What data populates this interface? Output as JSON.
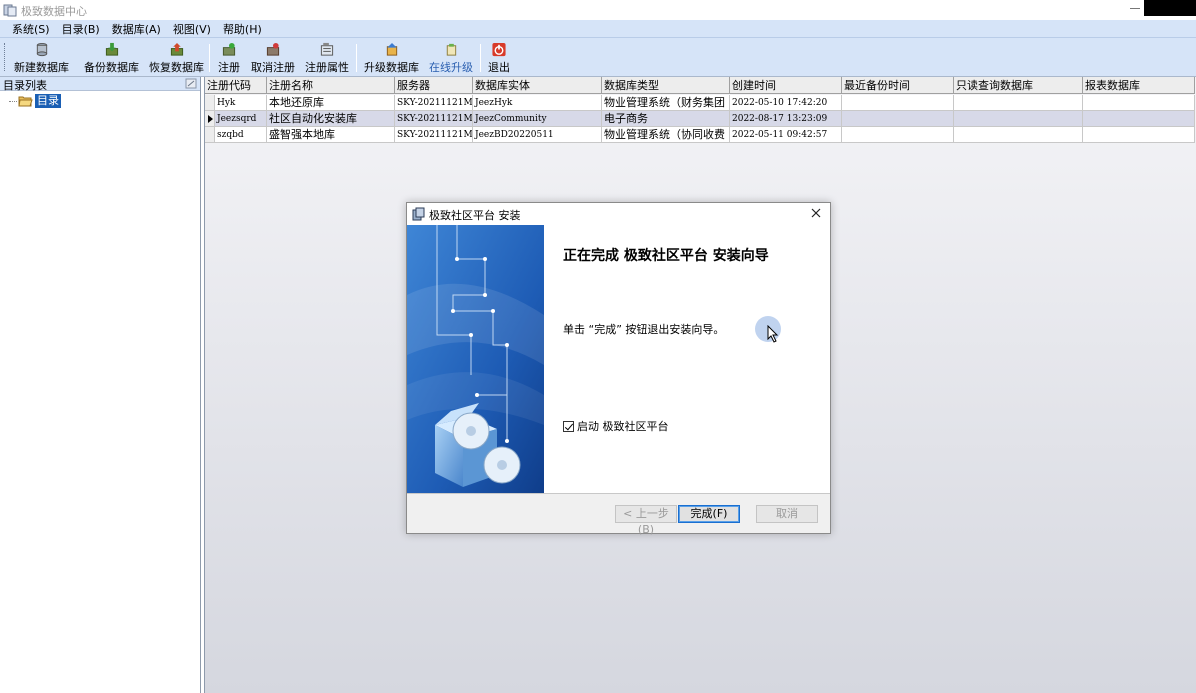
{
  "window": {
    "title": "极致数据中心"
  },
  "menu": [
    "系统(S)",
    "目录(B)",
    "数据库(A)",
    "视图(V)",
    "帮助(H)"
  ],
  "toolbar": {
    "new_db": "新建数据库",
    "backup_db": "备份数据库",
    "restore_db": "恢复数据库",
    "register": "注册",
    "unregister": "取消注册",
    "reg_props": "注册属性",
    "upgrade_db": "升级数据库",
    "online_upgrade": "在线升级",
    "exit": "退出"
  },
  "left_panel": {
    "title": "目录列表",
    "tree_root": "目录"
  },
  "grid": {
    "columns": [
      "注册代码",
      "注册名称",
      "服务器",
      "数据库实体",
      "数据库类型",
      "创建时间",
      "最近备份时间",
      "只读查询数据库",
      "报表数据库"
    ],
    "rows": [
      [
        "Hyk",
        "本地还原库",
        "SKY-20211121M",
        "JeezHyk",
        "物业管理系统（财务集团",
        "2022-05-10 17:42:20",
        "",
        "",
        ""
      ],
      [
        "Jeezsqrd",
        "社区自动化安装库",
        "SKY-20211121M",
        "JeezCommunity",
        "电子商务",
        "2022-08-17 13:23:09",
        "",
        "",
        ""
      ],
      [
        "szqbd",
        "盛智强本地库",
        "SKY-20211121M",
        "JeezBD20220511",
        "物业管理系统（协同收费",
        "2022-05-11 09:42:57",
        "",
        "",
        ""
      ]
    ]
  },
  "dialog": {
    "title": "极致社区平台 安装",
    "heading": "正在完成 极致社区平台 安装向导",
    "message": "单击 “完成” 按钮退出安装向导。",
    "launch_checkbox": "启动 极致社区平台",
    "launch_checked": true,
    "back_button": "< 上一步(B)",
    "finish_button": "完成(F)",
    "cancel_button": "取消"
  },
  "colors": {
    "chrome": "#d6e4f8",
    "selection": "#1a5fb4",
    "side_panel": "#1d5fb0"
  }
}
